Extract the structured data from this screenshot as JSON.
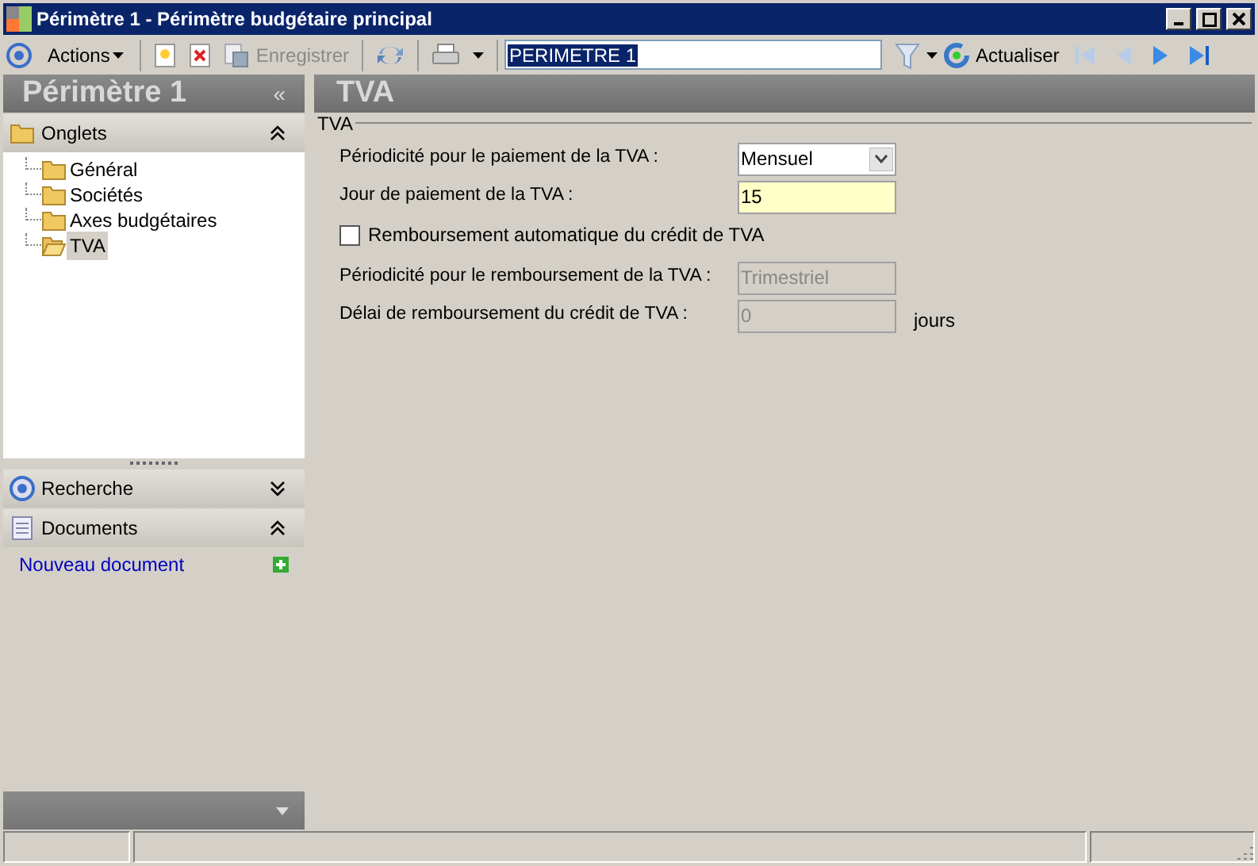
{
  "window": {
    "title": "Périmètre 1 -  Périmètre budgétaire principal"
  },
  "toolbar": {
    "actions": "Actions",
    "save": {
      "label": "Enregistrer",
      "disabled": true
    },
    "search": {
      "value": "PERIMETRE 1"
    },
    "refresh": "Actualiser"
  },
  "sidebar": {
    "title": "Périmètre 1",
    "collapse": "«",
    "sections": [
      {
        "kind": "tree",
        "title": "Onglets",
        "expanded": true,
        "items": [
          {
            "label": "Général",
            "selected": false
          },
          {
            "label": "Sociétés",
            "selected": false
          },
          {
            "label": "Axes budgétaires",
            "selected": false
          },
          {
            "label": "TVA",
            "selected": true
          }
        ]
      },
      {
        "kind": "search",
        "title": "Recherche",
        "expanded": false
      },
      {
        "kind": "documents",
        "title": "Documents",
        "expanded": true,
        "link": "Nouveau document"
      }
    ]
  },
  "content": {
    "title": "TVA",
    "group": "TVA",
    "fields": [
      {
        "kind": "select",
        "label": "Périodicité pour le paiement de la TVA :",
        "value": "Mensuel",
        "disabled": false
      },
      {
        "kind": "text",
        "label": "Jour de paiement de la TVA :",
        "value": "15",
        "disabled": false
      },
      {
        "kind": "checkbox",
        "label": "Remboursement automatique du crédit de TVA",
        "checked": false
      },
      {
        "kind": "text",
        "label": "Périodicité pour le remboursement de la TVA :",
        "value": "Trimestriel",
        "disabled": true
      },
      {
        "kind": "text",
        "label": "Délai de remboursement du crédit de TVA :",
        "value": "0",
        "disabled": true,
        "suffix": "jours"
      }
    ]
  }
}
